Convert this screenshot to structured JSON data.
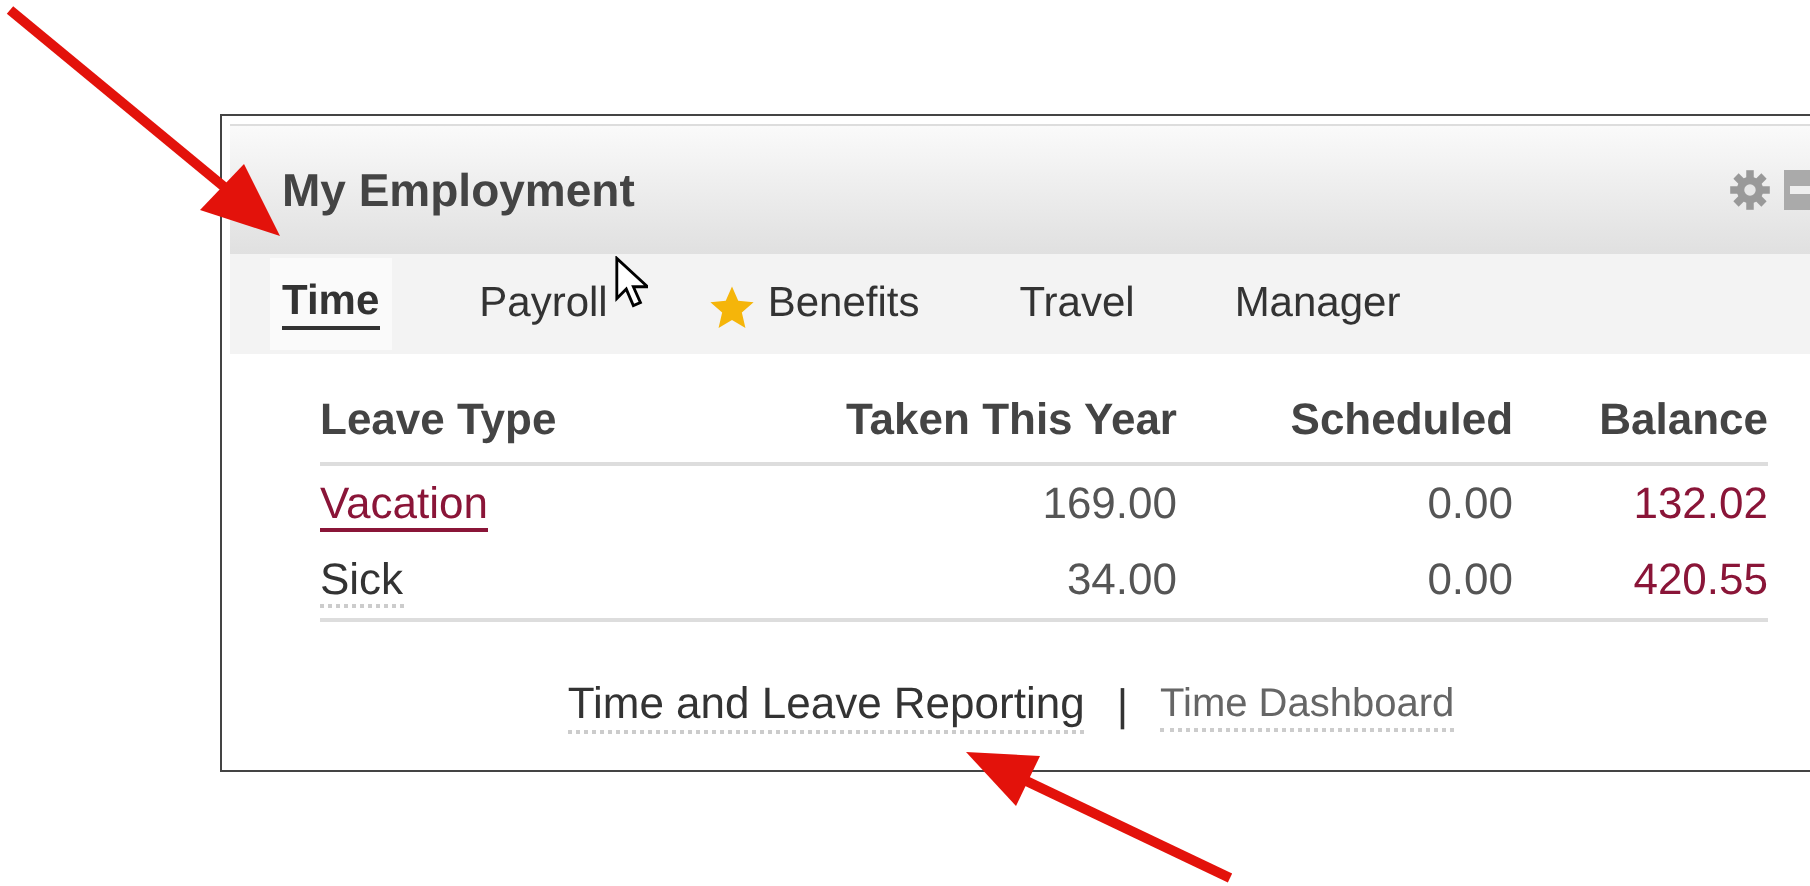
{
  "panel": {
    "title": "My Employment"
  },
  "tabs": [
    {
      "label": "Time",
      "selected": true,
      "starred": false
    },
    {
      "label": "Payroll",
      "selected": false,
      "starred": false
    },
    {
      "label": "Benefits",
      "selected": false,
      "starred": true
    },
    {
      "label": "Travel",
      "selected": false,
      "starred": false
    },
    {
      "label": "Manager",
      "selected": false,
      "starred": false
    }
  ],
  "table": {
    "columns": [
      "Leave Type",
      "Taken This Year",
      "Scheduled",
      "Balance"
    ],
    "rows": [
      {
        "leave_type": "Vacation",
        "link": true,
        "taken": "169.00",
        "scheduled": "0.00",
        "balance": "132.02"
      },
      {
        "leave_type": "Sick",
        "link": false,
        "taken": "34.00",
        "scheduled": "0.00",
        "balance": "420.55"
      }
    ]
  },
  "footer_links": [
    "Time and Leave Reporting",
    "|",
    "Time Dashboard"
  ]
}
